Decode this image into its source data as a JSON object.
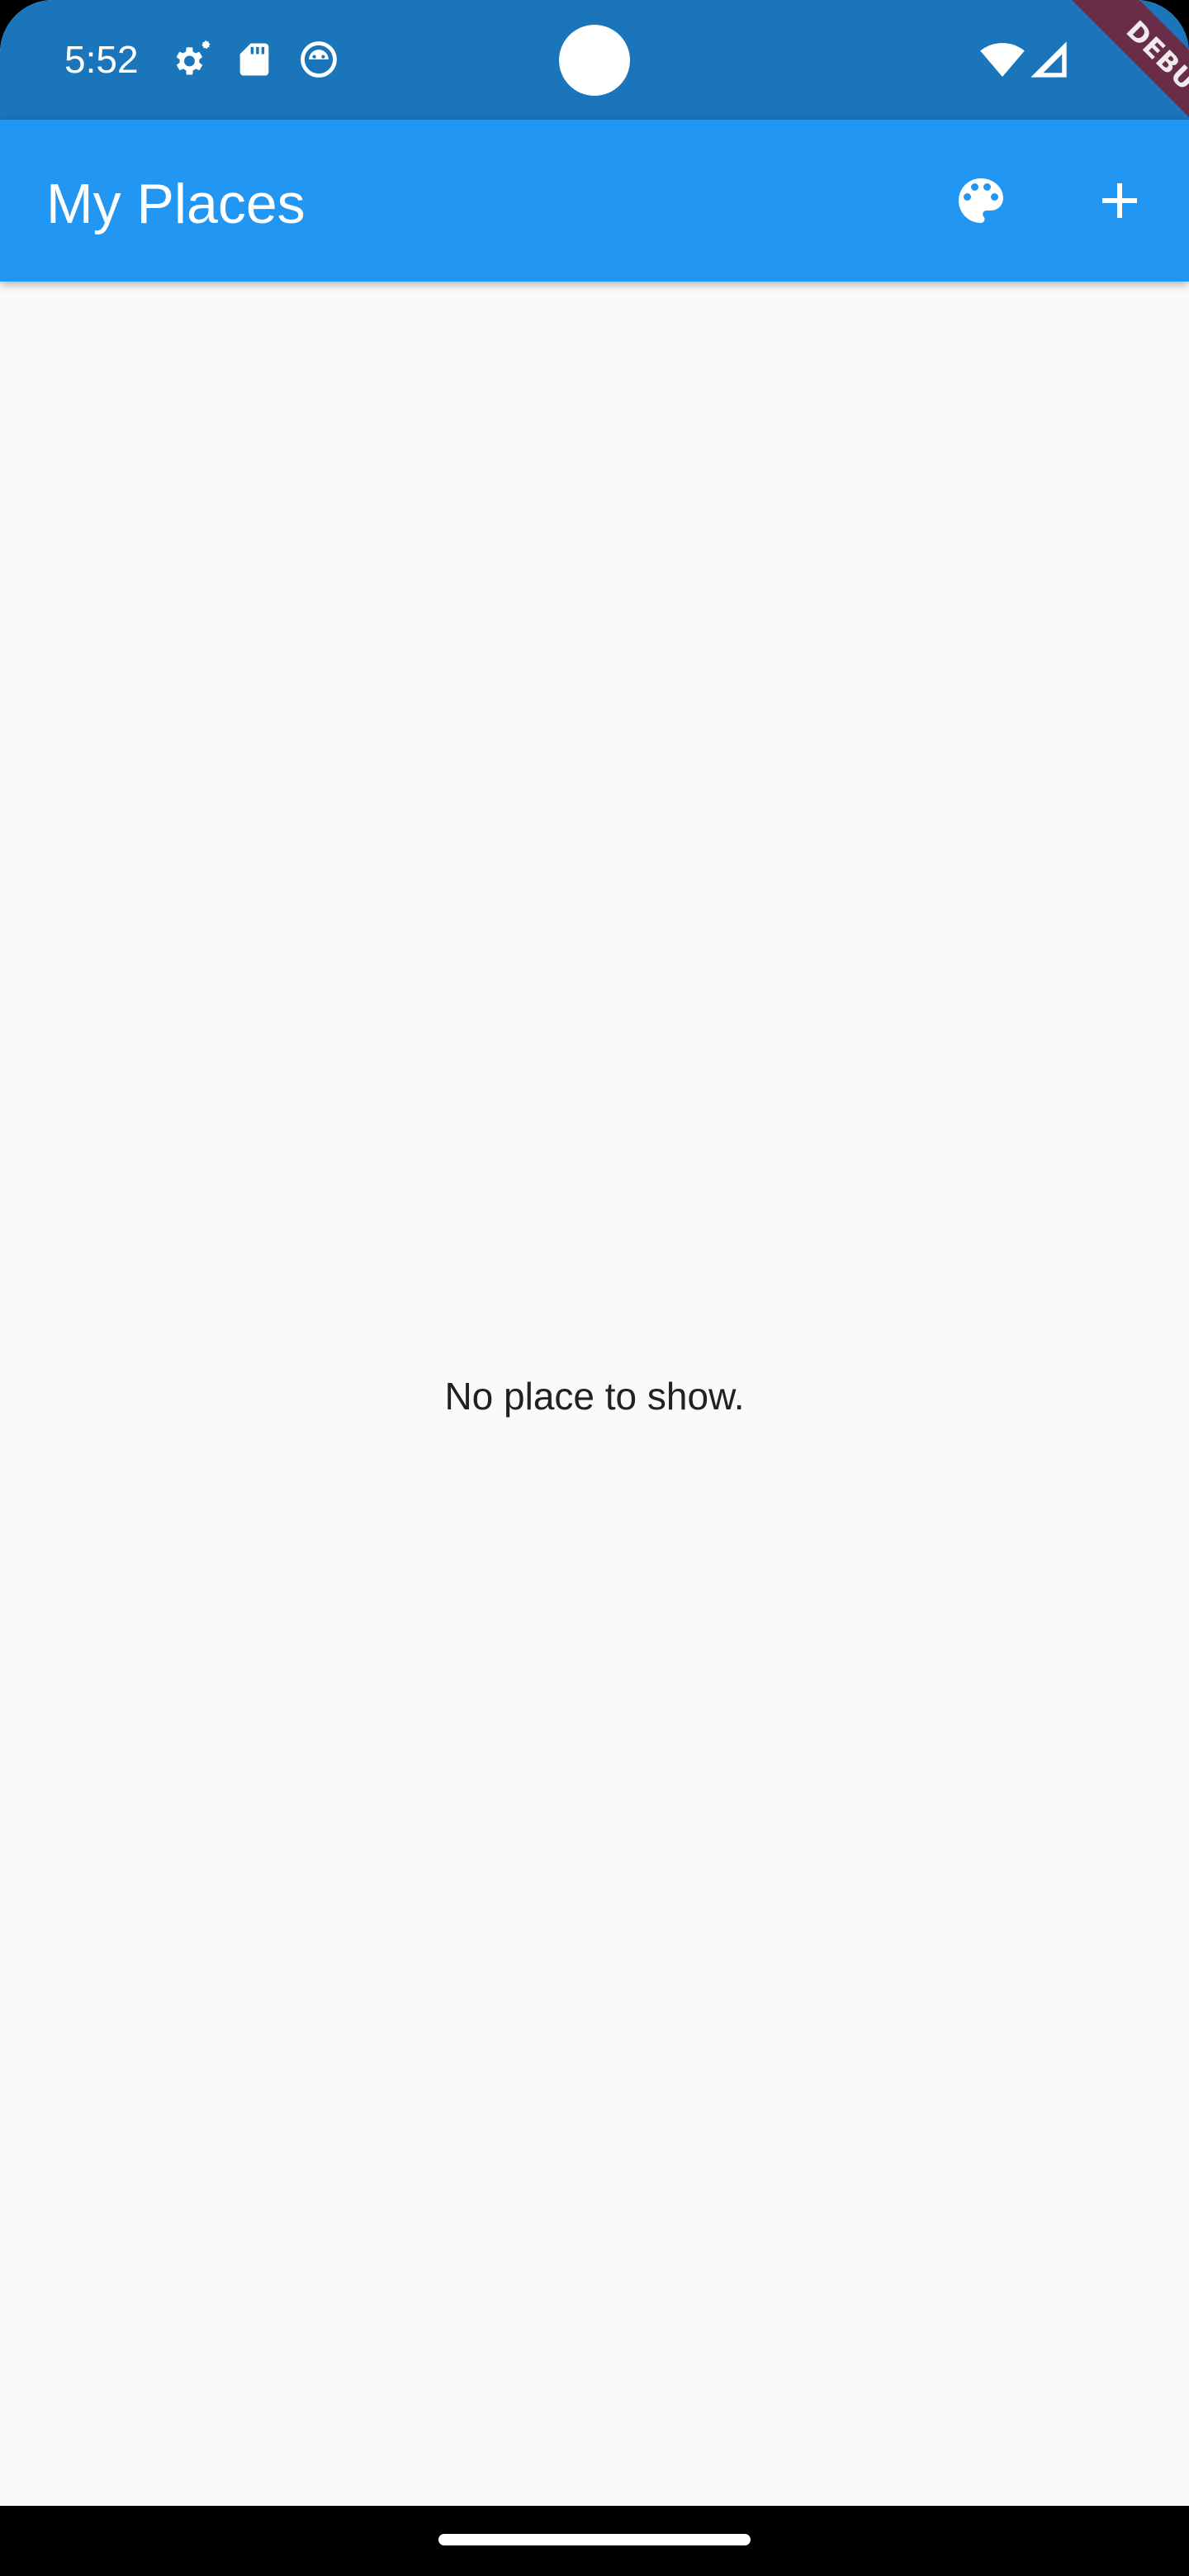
{
  "status_bar": {
    "time": "5:52",
    "left_icons": [
      "settings-gear-icon",
      "sd-card-icon",
      "android-face-icon"
    ],
    "right_icons": [
      "wifi-icon",
      "cellular-signal-icon"
    ],
    "background": "#1a75bb"
  },
  "app_bar": {
    "title": "My Places",
    "actions": [
      {
        "name": "palette-icon"
      },
      {
        "name": "add-icon"
      }
    ],
    "background": "#2196f3"
  },
  "main": {
    "empty_message": "No place to show."
  },
  "debug_banner": {
    "label": "DEBUG",
    "color": "#801828"
  }
}
